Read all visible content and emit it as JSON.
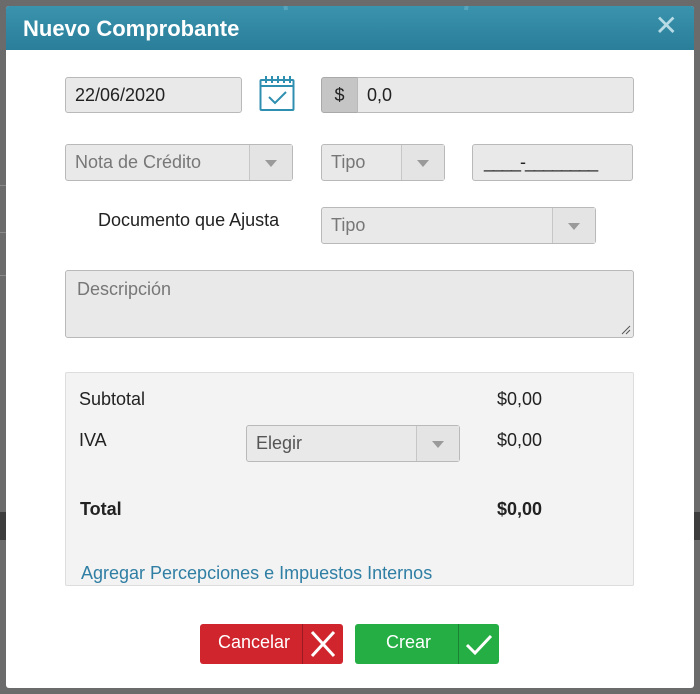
{
  "modal": {
    "title": "Nuevo Comprobante",
    "close_icon": "close-icon"
  },
  "form": {
    "date": "22/06/2020",
    "calendar_icon": "calendar-icon",
    "currency_symbol": "$",
    "amount": "0,0",
    "voucher_type": "Nota de Crédito",
    "tipo_placeholder": "Tipo",
    "number_mask": "____-________",
    "adjust_label": "Documento que Ajusta",
    "adjust_tipo_placeholder": "Tipo",
    "description_placeholder": "Descripción"
  },
  "totals": {
    "subtotal_label": "Subtotal",
    "subtotal_value": "$0,00",
    "iva_label": "IVA",
    "iva_select": "Elegir",
    "iva_value": "$0,00",
    "total_label": "Total",
    "total_value": "$0,00",
    "add_link": "Agregar Percepciones e Impuestos Internos"
  },
  "actions": {
    "cancel_label": "Cancelar",
    "create_label": "Crear"
  },
  "colors": {
    "header": "#2f87a3",
    "cancel": "#d0252d",
    "create": "#24ae44",
    "link": "#2f7ea4"
  }
}
